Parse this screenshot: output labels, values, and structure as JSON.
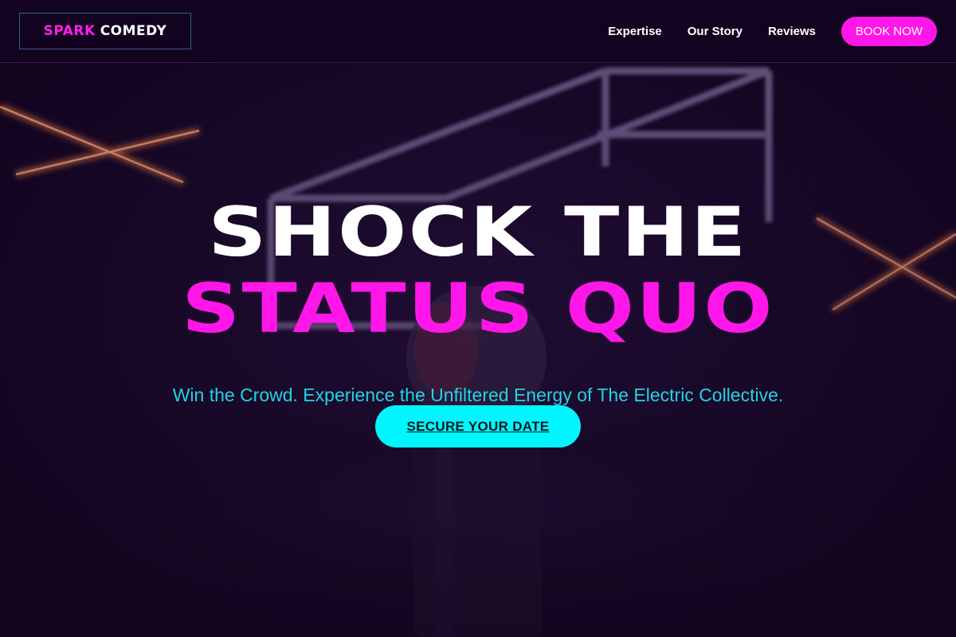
{
  "header": {
    "logo": {
      "word1": "SPARK",
      "word2": "COMEDY"
    },
    "nav": [
      {
        "label": "Expertise"
      },
      {
        "label": "Our Story"
      },
      {
        "label": "Reviews"
      }
    ],
    "book_label": "BOOK NOW"
  },
  "hero": {
    "headline_line1": "SHOCK THE",
    "headline_line2": "STATUS QUO",
    "subhead": "Win the Crowd. Experience the Unfiltered Energy of The Electric Collective.",
    "cta_label": "SECURE YOUR DATE",
    "background_image": "microphone-on-stage-with-neon-lights"
  },
  "colors": {
    "background": "#14061f",
    "accent_magenta": "#ff16e9",
    "accent_cyan": "#00f5ff",
    "subhead_cyan": "#22d3e6",
    "text_white": "#ffffff"
  }
}
